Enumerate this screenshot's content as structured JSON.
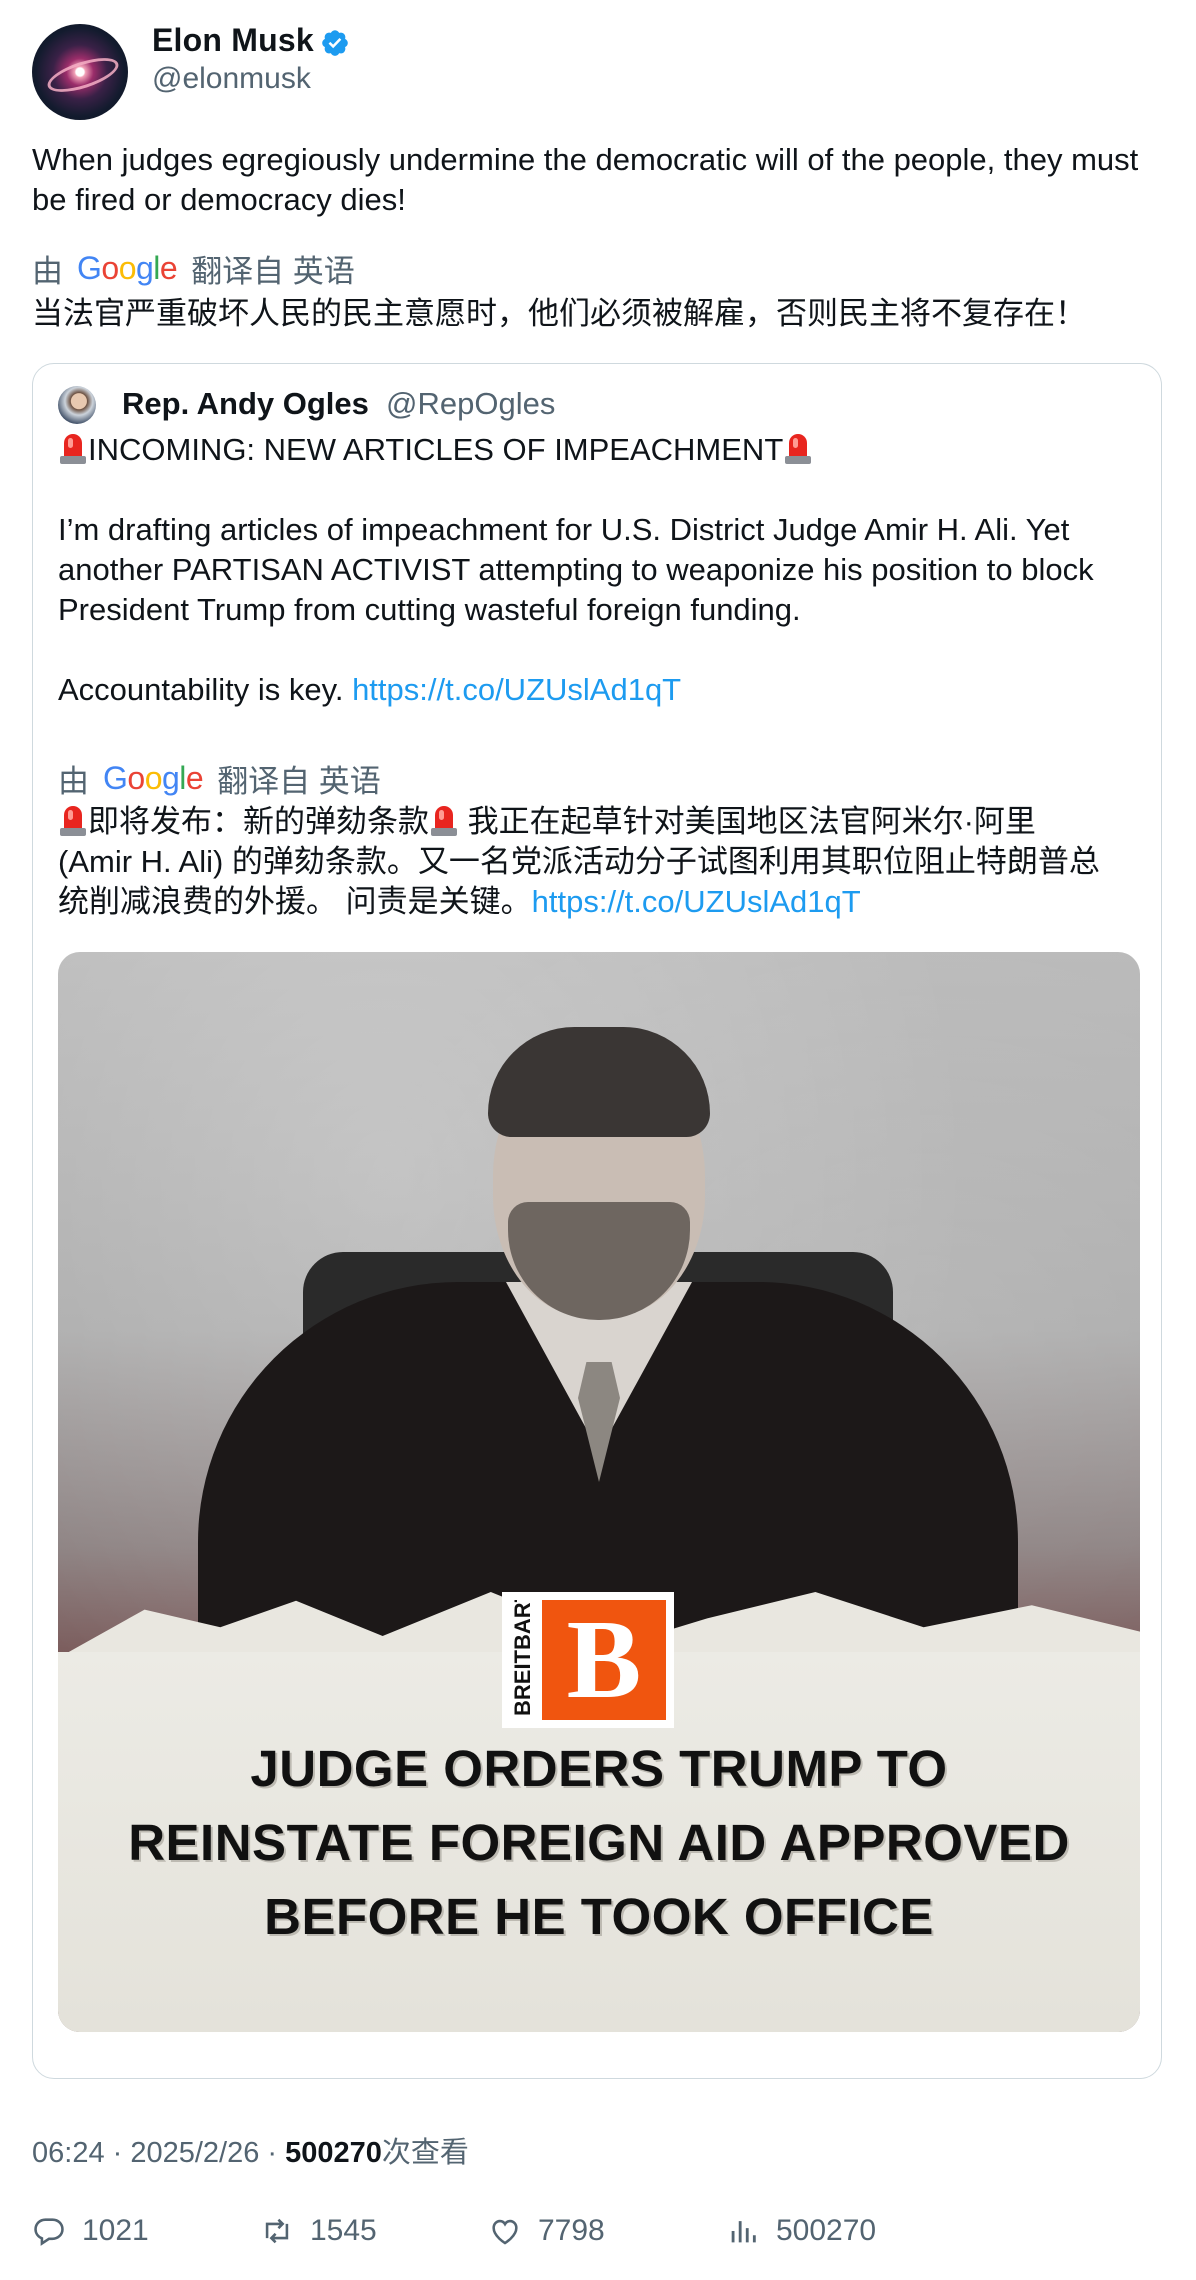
{
  "author": {
    "name": "Elon Musk",
    "handle": "@elonmusk",
    "verified_color": "#1d9bf0"
  },
  "tweet": {
    "text": "When judges egregiously undermine the democratic will of the people, they must be fired or democracy dies!",
    "translation_prefix": "由",
    "translation_suffix": "翻译自 英语",
    "google_logo": "Google",
    "translation": "当法官严重破坏人民的民主意愿时，他们必须被解雇，否则民主将不复存在！"
  },
  "quote": {
    "name": "Rep. Andy Ogles",
    "handle": "@RepOgles",
    "headline": "INCOMING: NEW ARTICLES OF IMPEACHMENT",
    "paragraph": "I’m drafting articles of impeachment for U.S. District Judge Amir H. Ali. Yet another PARTISAN ACTIVIST attempting to weaponize his position to block President Trump from cutting wasteful foreign funding.",
    "accountability": "Accountability is key.",
    "link": "https://t.co/UZUslAd1qT",
    "translation_prefix": "由",
    "translation_suffix": "翻译自 英语",
    "google_logo": "Google",
    "translation_line1a": "即将发布：新的弹劾条款",
    "translation_line1b": " 我正在起草针对美国地区法官阿米尔·阿里",
    "translation_line2": "(Amir H. Ali) 的弹劾条款。又一名党派活动分子试图利用其职位阻止特朗普总",
    "translation_line3": "统削减浪费的外援。 问责是关键。",
    "translation_link": "https://t.co/UZUslAd1qT",
    "image": {
      "brand_vertical": "BREITBART",
      "brand_letter": "B",
      "brand_color": "#f0550f",
      "headline_line1": "JUDGE ORDERS TRUMP TO",
      "headline_line2": "REINSTATE FOREIGN AID APPROVED",
      "headline_line3": "BEFORE HE TOOK OFFICE"
    }
  },
  "meta": {
    "time": "06:24 · 2025/2/26 · ",
    "views": "500270",
    "views_suffix": "次查看"
  },
  "actions": {
    "replies": "1021",
    "retweets": "1545",
    "likes": "7798",
    "views": "500270"
  }
}
